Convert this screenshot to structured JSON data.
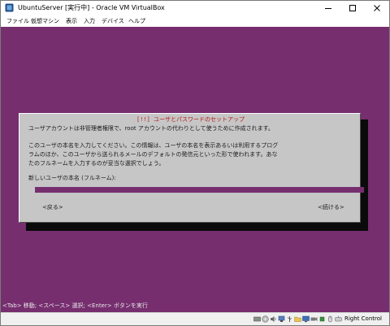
{
  "window": {
    "title": "UbuntuServer [実行中] - Oracle VM VirtualBox",
    "controls": [
      "minimize-icon",
      "maximize-icon",
      "close-icon"
    ]
  },
  "menubar": {
    "items": [
      "ファイル",
      "仮想マシン",
      "表示",
      "入力",
      "デバイス",
      "ヘルプ"
    ]
  },
  "dialog": {
    "title": "[!!] ユーザとパスワードのセットアップ",
    "line1": "ユーザアカウントは非管理者権限で、root アカウントの代わりとして使うために作成されます。",
    "para2": [
      "このユーザの本名を入力してください。この情報は、ユーザの本名を表示あるいは利用するプログ",
      "ラムのほか、このユーザから送られるメールのデフォルトの発信元といった形で使われます。あな",
      "たのフルネームを入力するのが妥当な選択でしょう。"
    ],
    "field_label": "新しいユーザの本名 (フルネーム):",
    "field_value": "",
    "back_button": "<戻る>",
    "continue_button": "<続ける>"
  },
  "console_hint": "<Tab> 移動; <スペース> 選択; <Enter> ボタンを実行",
  "statusbar": {
    "icons": [
      "hard-disk-icon",
      "optical-drive-icon",
      "audio-icon",
      "network-icon",
      "usb-icon",
      "shared-folder-icon",
      "display-icon",
      "video-capture-icon",
      "cpu-icon",
      "mouse-integration-icon",
      "keyboard-icon"
    ],
    "host_key": "Right Control"
  },
  "colors": {
    "console_background": "#762e6f",
    "dialog_background": "#c6c6c6",
    "dialog_title": "#b51818"
  }
}
